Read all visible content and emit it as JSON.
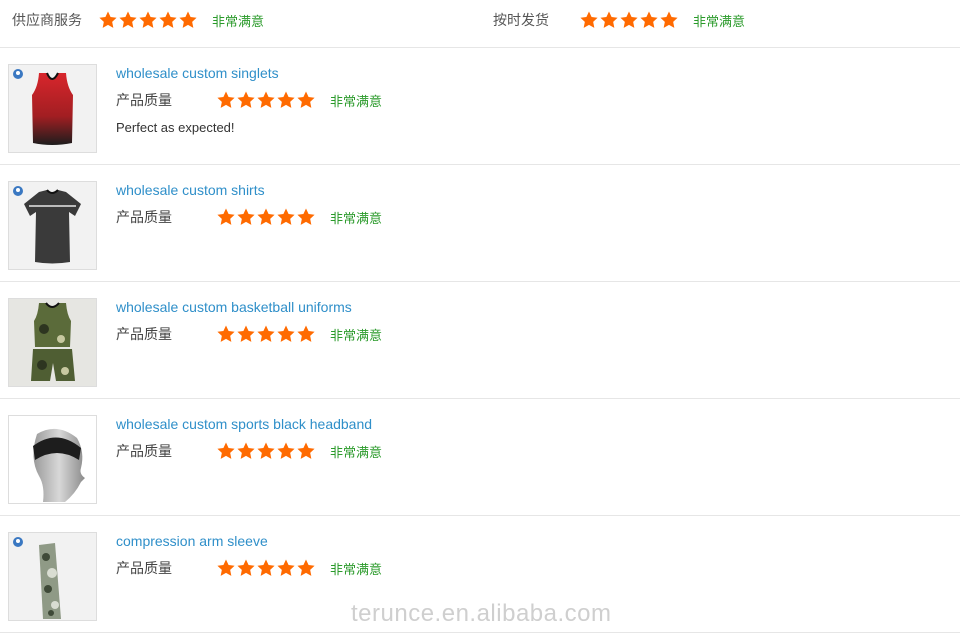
{
  "summary": {
    "supplier_service": {
      "label": "供应商服务",
      "rating": 5,
      "max": 5,
      "text": "非常满意"
    },
    "on_time_delivery": {
      "label": "按时发货",
      "rating": 5,
      "max": 5,
      "text": "非常满意"
    }
  },
  "reviews": [
    {
      "product": "wholesale custom singlets",
      "quality_label": "产品质量",
      "rating": 5,
      "rating_text": "非常满意",
      "comment": "Perfect as expected!",
      "thumb": "red-black-singlet"
    },
    {
      "product": "wholesale custom shirts",
      "quality_label": "产品质量",
      "rating": 5,
      "rating_text": "非常满意",
      "comment": "",
      "thumb": "black-tshirt"
    },
    {
      "product": "wholesale custom basketball uniforms",
      "quality_label": "产品质量",
      "rating": 5,
      "rating_text": "非常满意",
      "comment": "",
      "thumb": "camo-basketball-uniform"
    },
    {
      "product": "wholesale custom sports black headband",
      "quality_label": "产品质量",
      "rating": 5,
      "rating_text": "非常满意",
      "comment": "",
      "thumb": "black-headband-mannequin"
    },
    {
      "product": "compression arm sleeve",
      "quality_label": "产品质量",
      "rating": 5,
      "rating_text": "非常满意",
      "comment": "",
      "thumb": "camo-arm-sleeve"
    }
  ],
  "watermark": "terunce.en.alibaba.com",
  "colors": {
    "star": "#ff6a00",
    "rating_text": "#2a9a2a",
    "link": "#2f8fc9",
    "divider": "#e6e6e6"
  }
}
